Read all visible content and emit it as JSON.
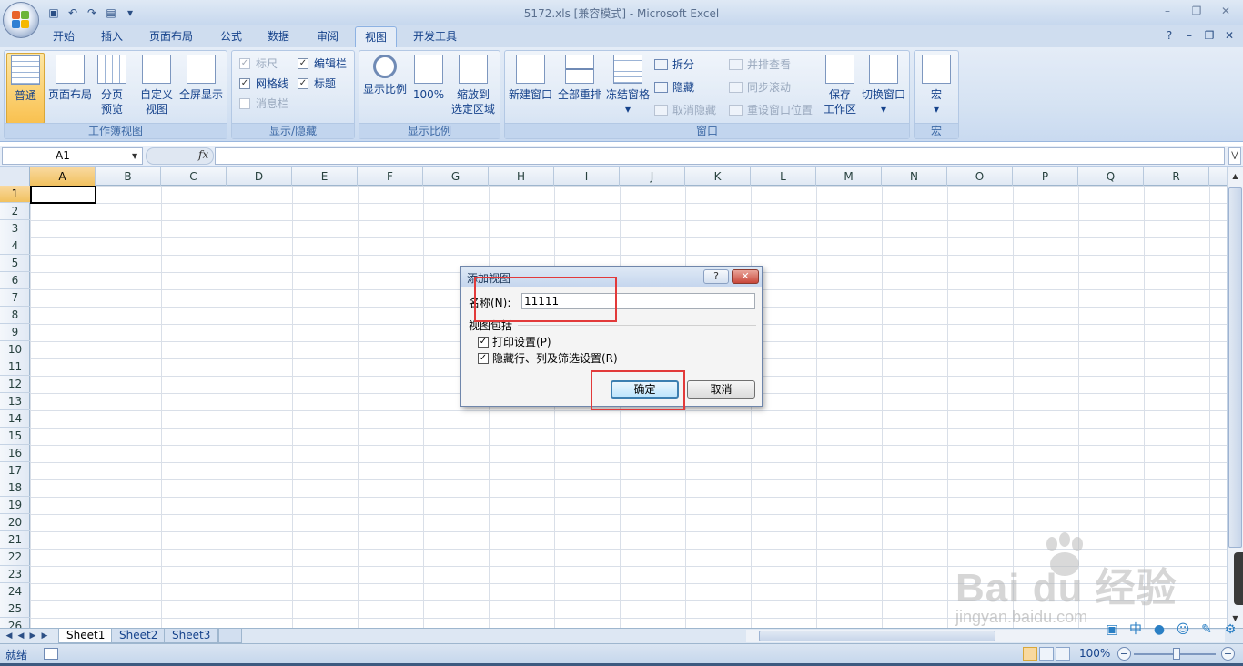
{
  "window": {
    "title": "5172.xls  [兼容模式] - Microsoft Excel"
  },
  "tabs": [
    {
      "label": "开始"
    },
    {
      "label": "插入"
    },
    {
      "label": "页面布局"
    },
    {
      "label": "公式"
    },
    {
      "label": "数据"
    },
    {
      "label": "审阅"
    },
    {
      "label": "视图",
      "active": true
    },
    {
      "label": "开发工具"
    }
  ],
  "ribbon": {
    "workbook_views": {
      "label": "工作簿视图",
      "normal": "普通",
      "page_layout": "页面布局",
      "page_break_1": "分页",
      "page_break_2": "预览",
      "custom_1": "自定义",
      "custom_2": "视图",
      "fullscreen": "全屏显示"
    },
    "show_hide": {
      "label": "显示/隐藏",
      "ruler": "标尺",
      "gridlines": "网格线",
      "message_bar": "消息栏",
      "formula_bar": "编辑栏",
      "headings": "标题"
    },
    "zoom": {
      "label": "显示比例",
      "zoom": "显示比例",
      "zoom_100": "100%",
      "zoom_sel_1": "缩放到",
      "zoom_sel_2": "选定区域"
    },
    "window": {
      "label": "窗口",
      "new_window": "新建窗口",
      "arrange_all": "全部重排",
      "freeze_panes": "冻结窗格",
      "split": "拆分",
      "hide": "隐藏",
      "unhide": "取消隐藏",
      "side_by_side": "并排查看",
      "sync_scroll": "同步滚动",
      "reset_position": "重设窗口位置",
      "save_ws_1": "保存",
      "save_ws_2": "工作区",
      "switch_windows": "切换窗口"
    },
    "macros": {
      "label": "宏",
      "macros": "宏"
    }
  },
  "formula_bar": {
    "name_box": "A1",
    "fx": "fx",
    "value": ""
  },
  "grid": {
    "columns": [
      "A",
      "B",
      "C",
      "D",
      "E",
      "F",
      "G",
      "H",
      "I",
      "J",
      "K",
      "L",
      "M",
      "N",
      "O",
      "P",
      "Q",
      "R"
    ],
    "rows": [
      "1",
      "2",
      "3",
      "4",
      "5",
      "6",
      "7",
      "8",
      "9",
      "10",
      "11",
      "12",
      "13",
      "14",
      "15",
      "16",
      "17",
      "18",
      "19",
      "20",
      "21",
      "22",
      "23",
      "24",
      "25",
      "26"
    ],
    "active_cell": "A1"
  },
  "sheets": [
    "Sheet1",
    "Sheet2",
    "Sheet3"
  ],
  "status": {
    "text": "就绪",
    "zoom": "100%"
  },
  "dialog": {
    "title": "添加视图",
    "help": "?",
    "name_label": "名称(N):",
    "name_value": "11111",
    "includes_label": "视图包括",
    "print_settings": "打印设置(P)",
    "hidden_settings": "隐藏行、列及筛选设置(R)",
    "ok": "确定",
    "cancel": "取消"
  },
  "watermark": {
    "main": "Bai  du 经验",
    "sub": "jingyan.baidu.com"
  },
  "colors": {
    "accent": "#15428b",
    "ribbon_bg": "#d6e3f3",
    "highlight_box": "#e23a3a",
    "active_header": "#f1c15f"
  }
}
